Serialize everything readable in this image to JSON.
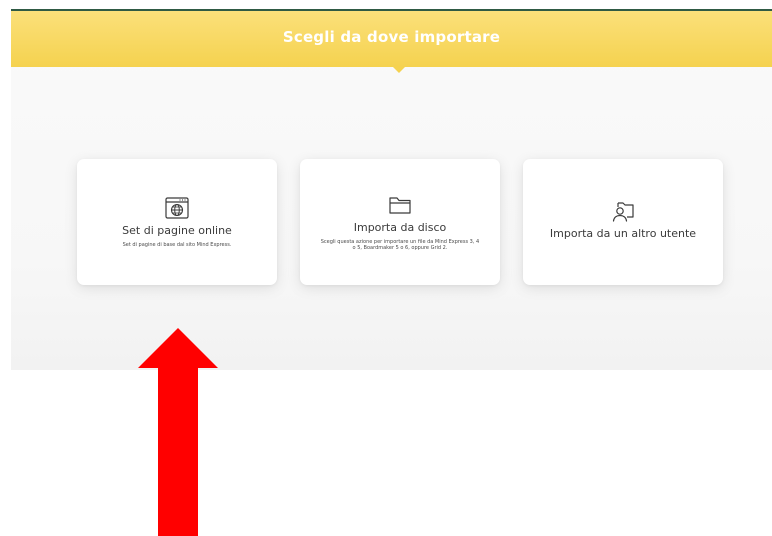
{
  "header": {
    "title": "Scegli da dove importare"
  },
  "cards": [
    {
      "icon": "browser-globe-icon",
      "title": "Set di pagine online",
      "description": "Set di pagine di base dal sito Mind Express."
    },
    {
      "icon": "folder-icon",
      "title": "Importa da disco",
      "description": "Scegli questa azione per importare un file da Mind Express 3, 4 o 5, Boardmaker 5 o 6, oppure Grid 2."
    },
    {
      "icon": "user-folder-icon",
      "title": "Importa da un altro utente",
      "description": ""
    }
  ],
  "annotation": {
    "arrow_color": "#ff0000"
  },
  "colors": {
    "header": "#f5d24f",
    "top_border": "#2f5a44"
  }
}
